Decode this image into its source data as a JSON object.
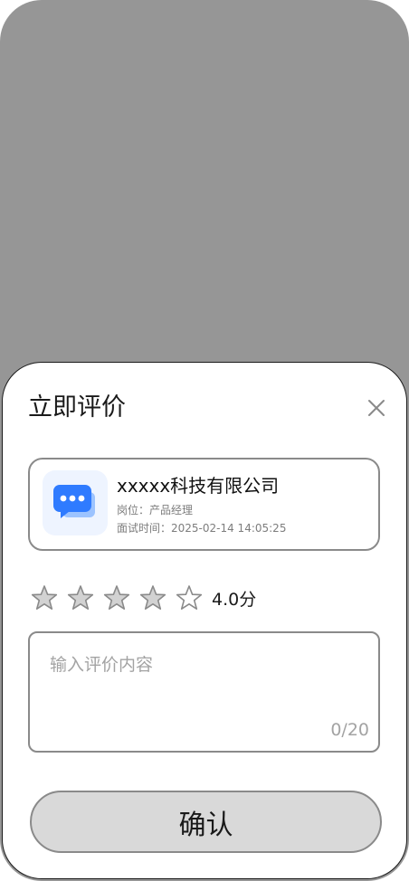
{
  "sheet": {
    "title": "立即评价",
    "close_icon": "close-icon"
  },
  "company": {
    "logo_icon": "chat-bubble-icon",
    "logo_color": "#2f7bff",
    "name": "xxxxx科技有限公司",
    "position": "岗位：产品经理",
    "interview_time": "面试时间：2025-02-14 14:05:25"
  },
  "rating": {
    "stars_total": 5,
    "filled_stars": 4,
    "star_filled_color": "#d2d2d2",
    "score_label": "4.0分"
  },
  "comment": {
    "placeholder": "输入评价内容",
    "value": "",
    "counter": "0/20"
  },
  "confirm": {
    "label": "确认"
  }
}
